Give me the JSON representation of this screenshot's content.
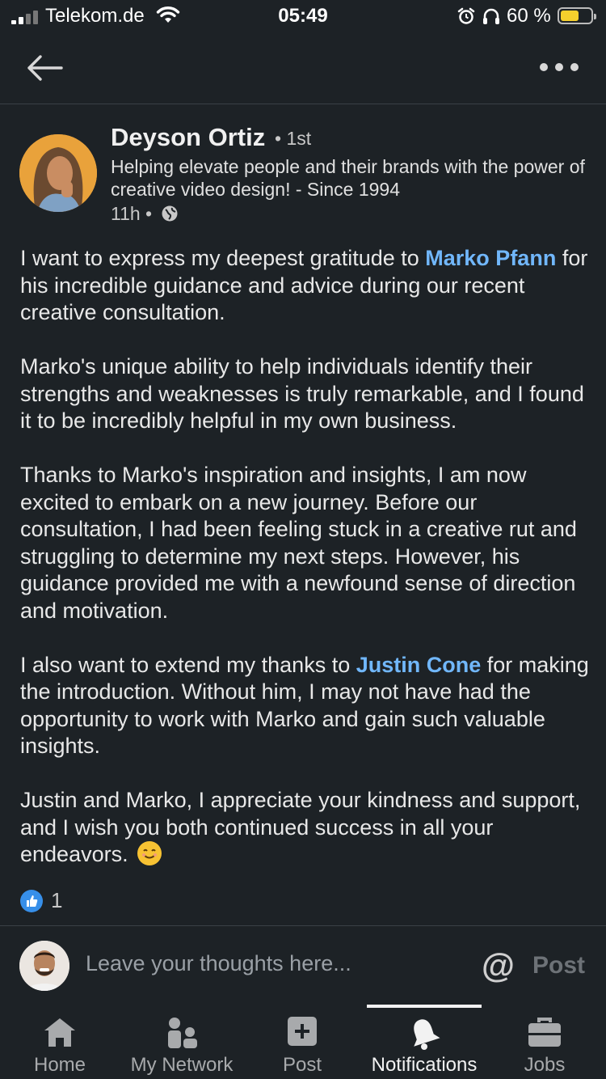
{
  "status_bar": {
    "carrier": "Telekom.de",
    "time": "05:49",
    "battery_percent": "60 %",
    "battery_level": 0.6
  },
  "post": {
    "author": {
      "name": "Deyson Ortiz",
      "connection": "• 1st",
      "headline": "Helping elevate people and their brands with the power of creative video design! - Since 1994",
      "time_ago": "11h •"
    },
    "paragraphs": [
      {
        "parts": [
          {
            "text": "I want to express my deepest gratitude to ",
            "mention": false
          },
          {
            "text": "Marko Pfann",
            "mention": true
          },
          {
            "text": " for his incredible guidance and advice during our recent creative consultation.",
            "mention": false
          }
        ]
      },
      {
        "parts": [
          {
            "text": "Marko's unique ability to help individuals identify their strengths and weaknesses is truly remarkable, and I found it to be incredibly helpful in my own business.",
            "mention": false
          }
        ]
      },
      {
        "parts": [
          {
            "text": "Thanks to Marko's inspiration and insights, I am now excited to embark on a new journey. Before our consultation, I had been feeling stuck in a creative rut and struggling to determine my next steps. However, his guidance provided me with a newfound sense of direction and motivation.",
            "mention": false
          }
        ]
      },
      {
        "parts": [
          {
            "text": "I also want to extend my thanks to ",
            "mention": false
          },
          {
            "text": "Justin Cone",
            "mention": true
          },
          {
            "text": " for making the introduction. Without him, I may not have had the opportunity to work with Marko and gain such valuable insights.",
            "mention": false
          }
        ]
      },
      {
        "parts": [
          {
            "text": "Justin and Marko, I appreciate your kindness and support, and I wish you both continued success in all your endeavors. ",
            "mention": false
          }
        ],
        "trailing_emoji": "smiling-face-emoji"
      }
    ],
    "reactions": {
      "count": "1",
      "icon": "like-icon"
    }
  },
  "comment_bar": {
    "placeholder": "Leave your thoughts here...",
    "at_symbol": "@",
    "post_label": "Post"
  },
  "nav": {
    "items": [
      {
        "label": "Home",
        "icon": "home-icon"
      },
      {
        "label": "My Network",
        "icon": "network-icon"
      },
      {
        "label": "Post",
        "icon": "plus-square-icon"
      },
      {
        "label": "Notifications",
        "icon": "bell-icon",
        "active": true
      },
      {
        "label": "Jobs",
        "icon": "briefcase-icon"
      }
    ]
  },
  "colors": {
    "background": "#1d2226",
    "mention": "#71b7fb",
    "text": "#e8e8e8",
    "battery": "#f5cf2d",
    "like": "#378fe9"
  }
}
